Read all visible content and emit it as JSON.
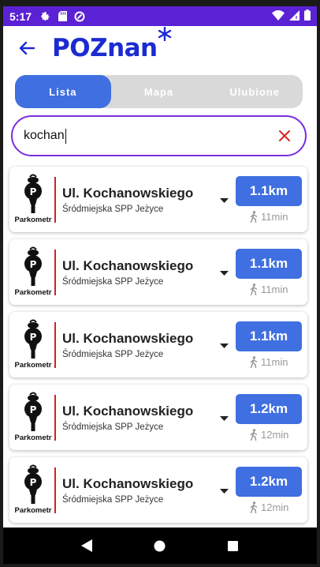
{
  "status_bar": {
    "time": "5:17",
    "icons": [
      "gear-icon",
      "sd-card-icon",
      "data-saver-icon",
      "wifi-icon",
      "signal-icon",
      "battery-icon"
    ]
  },
  "app_bar": {
    "logo_upper": "POZ",
    "logo_lower": "nan",
    "accent_color": "#1b2bd0"
  },
  "tabs": [
    {
      "label": "Lista",
      "active": true
    },
    {
      "label": "Mapa",
      "active": false
    },
    {
      "label": "Ulubione",
      "active": false
    }
  ],
  "search": {
    "value": "kochan",
    "border_color": "#7b2ee0",
    "clear_color": "#e02020"
  },
  "results": [
    {
      "meter_label": "Parkometr",
      "street": "Ul. Kochanowskiego",
      "zone": "Śródmiejska SPP Jeżyce",
      "distance": "1.1km",
      "walk_time": "11min"
    },
    {
      "meter_label": "Parkometr",
      "street": "Ul. Kochanowskiego",
      "zone": "Śródmiejska SPP Jeżyce",
      "distance": "1.1km",
      "walk_time": "11min"
    },
    {
      "meter_label": "Parkometr",
      "street": "Ul. Kochanowskiego",
      "zone": "Śródmiejska SPP Jeżyce",
      "distance": "1.1km",
      "walk_time": "11min"
    },
    {
      "meter_label": "Parkometr",
      "street": "Ul. Kochanowskiego",
      "zone": "Śródmiejska SPP Jeżyce",
      "distance": "1.2km",
      "walk_time": "12min"
    },
    {
      "meter_label": "Parkometr",
      "street": "Ul. Kochanowskiego",
      "zone": "Śródmiejska SPP Jeżyce",
      "distance": "1.2km",
      "walk_time": "12min"
    }
  ],
  "colors": {
    "status_bar": "#5b21d4",
    "primary_button": "#3f6fe0",
    "divider": "#d62020"
  },
  "nav_bar": [
    "back-triangle-icon",
    "home-circle-icon",
    "recents-square-icon"
  ]
}
